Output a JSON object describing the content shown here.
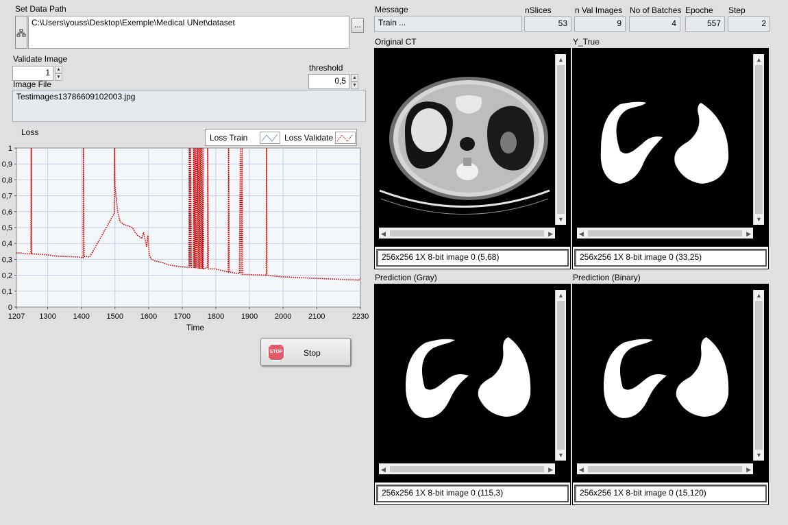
{
  "data_path": {
    "label": "Set Data Path",
    "value": "C:\\Users\\youss\\Desktop\\Exemple\\Medical UNet\\dataset",
    "browse_label": "..."
  },
  "validate_image": {
    "label": "Validate Image",
    "value": "1"
  },
  "threshold": {
    "label": "threshold",
    "value": "0,5"
  },
  "image_file": {
    "label": "Image File",
    "value": "Testimages13786609102003.jpg"
  },
  "indicators": {
    "message": {
      "label": "Message",
      "value": "Train ..."
    },
    "nslices": {
      "label": "nSlices",
      "value": "53"
    },
    "nval": {
      "label": "n Val Images",
      "value": "9"
    },
    "batches": {
      "label": "No of Batches",
      "value": "4"
    },
    "epoche": {
      "label": "Epoche",
      "value": "557"
    },
    "step": {
      "label": "Step",
      "value": "2"
    }
  },
  "stop_button": {
    "label": "Stop",
    "icon": "stop-sign-icon",
    "icon_text": "STOP"
  },
  "images": {
    "original": {
      "title": "Original CT",
      "status": "256x256 1X 8-bit image 0    (5,68)"
    },
    "ytrue": {
      "title": "Y_True",
      "status": "256x256 1X 8-bit image 0    (33,25)"
    },
    "pred_gray": {
      "title": "Prediction (Gray)",
      "status": "256x256 1X 8-bit image 0    (115,3)"
    },
    "pred_bin": {
      "title": "Prediction (Binary)",
      "status": "256x256 1X 8-bit image 0    (15,120)"
    }
  },
  "chart_data": {
    "type": "line",
    "title": "Loss",
    "xlabel": "Time",
    "ylabel": "",
    "xlim": [
      1207,
      2230
    ],
    "ylim": [
      0,
      1
    ],
    "x_ticks": [
      "1207",
      "1300",
      "1400",
      "1500",
      "1600",
      "1700",
      "1800",
      "1900",
      "2000",
      "2100",
      "2230"
    ],
    "y_ticks": [
      "0",
      "0,1",
      "0,2",
      "0,3",
      "0,4",
      "0,5",
      "0,6",
      "0,7",
      "0,8",
      "0,9",
      "1"
    ],
    "grid": true,
    "legend": "top-right",
    "series": [
      {
        "name": "Loss Train",
        "color": "#6a9fd4",
        "points": []
      },
      {
        "name": "Loss Validate",
        "color": "#cc0000",
        "points": [
          [
            1207,
            0.34
          ],
          [
            1220,
            0.34
          ],
          [
            1235,
            0.335
          ],
          [
            1250,
            0.335
          ],
          [
            1251,
            1
          ],
          [
            1252,
            0.335
          ],
          [
            1290,
            0.33
          ],
          [
            1310,
            0.325
          ],
          [
            1330,
            0.32
          ],
          [
            1390,
            0.315
          ],
          [
            1405,
            0.31
          ],
          [
            1406,
            1
          ],
          [
            1408,
            0.32
          ],
          [
            1425,
            0.315
          ],
          [
            1498,
            0.59
          ],
          [
            1499,
            1
          ],
          [
            1500,
            0.76
          ],
          [
            1503,
            0.7
          ],
          [
            1508,
            0.6
          ],
          [
            1515,
            0.54
          ],
          [
            1525,
            0.52
          ],
          [
            1540,
            0.51
          ],
          [
            1552,
            0.5
          ],
          [
            1560,
            0.47
          ],
          [
            1568,
            0.45
          ],
          [
            1575,
            0.44
          ],
          [
            1580,
            0.43
          ],
          [
            1585,
            0.47
          ],
          [
            1590,
            0.42
          ],
          [
            1594,
            0.38
          ],
          [
            1598,
            0.45
          ],
          [
            1602,
            0.33
          ],
          [
            1608,
            0.3
          ],
          [
            1620,
            0.29
          ],
          [
            1640,
            0.28
          ],
          [
            1660,
            0.265
          ],
          [
            1690,
            0.255
          ],
          [
            1715,
            0.25
          ],
          [
            1720,
            0.25
          ],
          [
            1721,
            1
          ],
          [
            1723,
            0.25
          ],
          [
            1725,
            1
          ],
          [
            1727,
            0.25
          ],
          [
            1733,
            0.25
          ],
          [
            1734,
            1
          ],
          [
            1736,
            0.245
          ],
          [
            1738,
            1
          ],
          [
            1740,
            0.245
          ],
          [
            1742,
            1
          ],
          [
            1744,
            0.245
          ],
          [
            1746,
            1
          ],
          [
            1748,
            0.24
          ],
          [
            1750,
            1
          ],
          [
            1752,
            0.24
          ],
          [
            1754,
            1
          ],
          [
            1756,
            0.24
          ],
          [
            1758,
            1
          ],
          [
            1760,
            0.24
          ],
          [
            1762,
            1
          ],
          [
            1764,
            0.24
          ],
          [
            1775,
            0.25
          ],
          [
            1776,
            1
          ],
          [
            1778,
            0.24
          ],
          [
            1798,
            0.24
          ],
          [
            1837,
            0.22
          ],
          [
            1838,
            1
          ],
          [
            1840,
            0.22
          ],
          [
            1870,
            0.21
          ],
          [
            1873,
            1
          ],
          [
            1875,
            0.205
          ],
          [
            1878,
            1
          ],
          [
            1880,
            0.205
          ],
          [
            1950,
            0.2
          ],
          [
            1951,
            1
          ],
          [
            1952,
            0.2
          ],
          [
            1997,
            0.19
          ],
          [
            2047,
            0.185
          ],
          [
            2225,
            0.17
          ],
          [
            2230,
            0.18
          ]
        ]
      }
    ]
  }
}
